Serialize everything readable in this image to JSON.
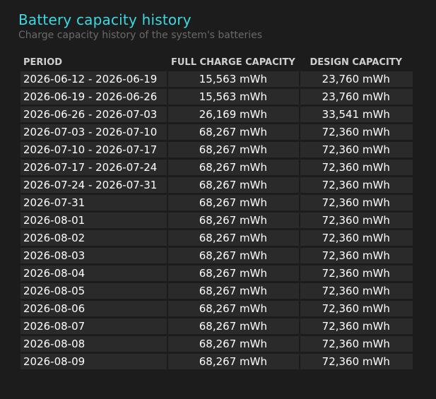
{
  "page": {
    "title": "Battery capacity history",
    "subtitle": "Charge capacity history of the system's batteries"
  },
  "table": {
    "headers": {
      "period": "PERIOD",
      "full_charge_capacity": "FULL CHARGE CAPACITY",
      "design_capacity": "DESIGN CAPACITY"
    },
    "rows": [
      {
        "period": "2026-06-12 - 2026-06-19",
        "full": "15,563 mWh",
        "design": "23,760 mWh"
      },
      {
        "period": "2026-06-19 - 2026-06-26",
        "full": "15,563 mWh",
        "design": "23,760 mWh"
      },
      {
        "period": "2026-06-26 - 2026-07-03",
        "full": "26,169 mWh",
        "design": "33,541 mWh"
      },
      {
        "period": "2026-07-03 - 2026-07-10",
        "full": "68,267 mWh",
        "design": "72,360 mWh"
      },
      {
        "period": "2026-07-10 - 2026-07-17",
        "full": "68,267 mWh",
        "design": "72,360 mWh"
      },
      {
        "period": "2026-07-17 - 2026-07-24",
        "full": "68,267 mWh",
        "design": "72,360 mWh"
      },
      {
        "period": "2026-07-24 - 2026-07-31",
        "full": "68,267 mWh",
        "design": "72,360 mWh"
      },
      {
        "period": "2026-07-31",
        "full": "68,267 mWh",
        "design": "72,360 mWh"
      },
      {
        "period": "2026-08-01",
        "full": "68,267 mWh",
        "design": "72,360 mWh"
      },
      {
        "period": "2026-08-02",
        "full": "68,267 mWh",
        "design": "72,360 mWh"
      },
      {
        "period": "2026-08-03",
        "full": "68,267 mWh",
        "design": "72,360 mWh"
      },
      {
        "period": "2026-08-04",
        "full": "68,267 mWh",
        "design": "72,360 mWh"
      },
      {
        "period": "2026-08-05",
        "full": "68,267 mWh",
        "design": "72,360 mWh"
      },
      {
        "period": "2026-08-06",
        "full": "68,267 mWh",
        "design": "72,360 mWh"
      },
      {
        "period": "2026-08-07",
        "full": "68,267 mWh",
        "design": "72,360 mWh"
      },
      {
        "period": "2026-08-08",
        "full": "68,267 mWh",
        "design": "72,360 mWh"
      },
      {
        "period": "2026-08-09",
        "full": "68,267 mWh",
        "design": "72,360 mWh"
      }
    ]
  },
  "colors": {
    "background": "#1c1c1c",
    "title": "#3dd9e0",
    "subtitle": "#6a6a6a",
    "cell_background": "#2a2a2a",
    "header_text": "#cfcfcf",
    "cell_text": "#ffffff"
  }
}
